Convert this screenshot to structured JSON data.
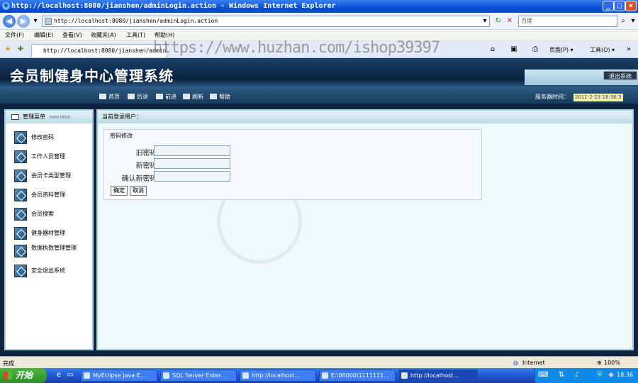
{
  "window": {
    "title": "http://localhost:8080/jianshen/adminLogin.action - Windows Internet Explorer",
    "min": "_",
    "max": "□",
    "close": "×"
  },
  "browser": {
    "url": "http://localhost:8080/jianshen/adminLogin.action",
    "search_placeholder": "百度",
    "menu": [
      "文件(F)",
      "编辑(E)",
      "查看(V)",
      "收藏夹(A)",
      "工具(T)",
      "帮助(H)"
    ],
    "tab_label": "http://localhost:8080/jianshen/adminLogin",
    "watermark": "https://www.huzhan.com/ishop39397",
    "toolbar": {
      "page": "页面(P) ▾",
      "tools": "工具(O) ▾"
    }
  },
  "app": {
    "title": "会员制健身中心管理系统",
    "logout": "退出系统",
    "nav": [
      "首页",
      "后退",
      "前进",
      "刷新",
      "帮助"
    ],
    "server_time_label": "服务器时间：",
    "server_time_value": "2011-2-23 18:36:3"
  },
  "sidebar": {
    "header": "管理菜单",
    "header_sub": "MAIN MENU",
    "items": [
      {
        "label": "修改密码"
      },
      {
        "label": "工作人员管理"
      },
      {
        "label": "会员卡类型管理"
      },
      {
        "label": "会员资料管理"
      },
      {
        "label": "会员搜索"
      },
      {
        "label": "健身器材管理"
      },
      {
        "label": "数据执数管理管理"
      },
      {
        "label": "安全退出系统"
      }
    ]
  },
  "main": {
    "current_user": "当前登录用户：",
    "panel_title": "密码修改",
    "fields": [
      {
        "label": "旧密码:",
        "value": ""
      },
      {
        "label": "新密码:",
        "value": ""
      },
      {
        "label": "确认新密码:",
        "value": ""
      }
    ],
    "confirm": "确定",
    "cancel": "取消"
  },
  "statusbar": {
    "left": "完成",
    "zone": "Internet",
    "zoom": "100%"
  },
  "taskbar": {
    "start": "开始",
    "tasks": [
      "MyEclipse Java E...",
      "SQL Server Enter...",
      "http://localhost...",
      "E:\\00000\\1111111...",
      "http://localhost..."
    ],
    "clock": "18:36"
  }
}
